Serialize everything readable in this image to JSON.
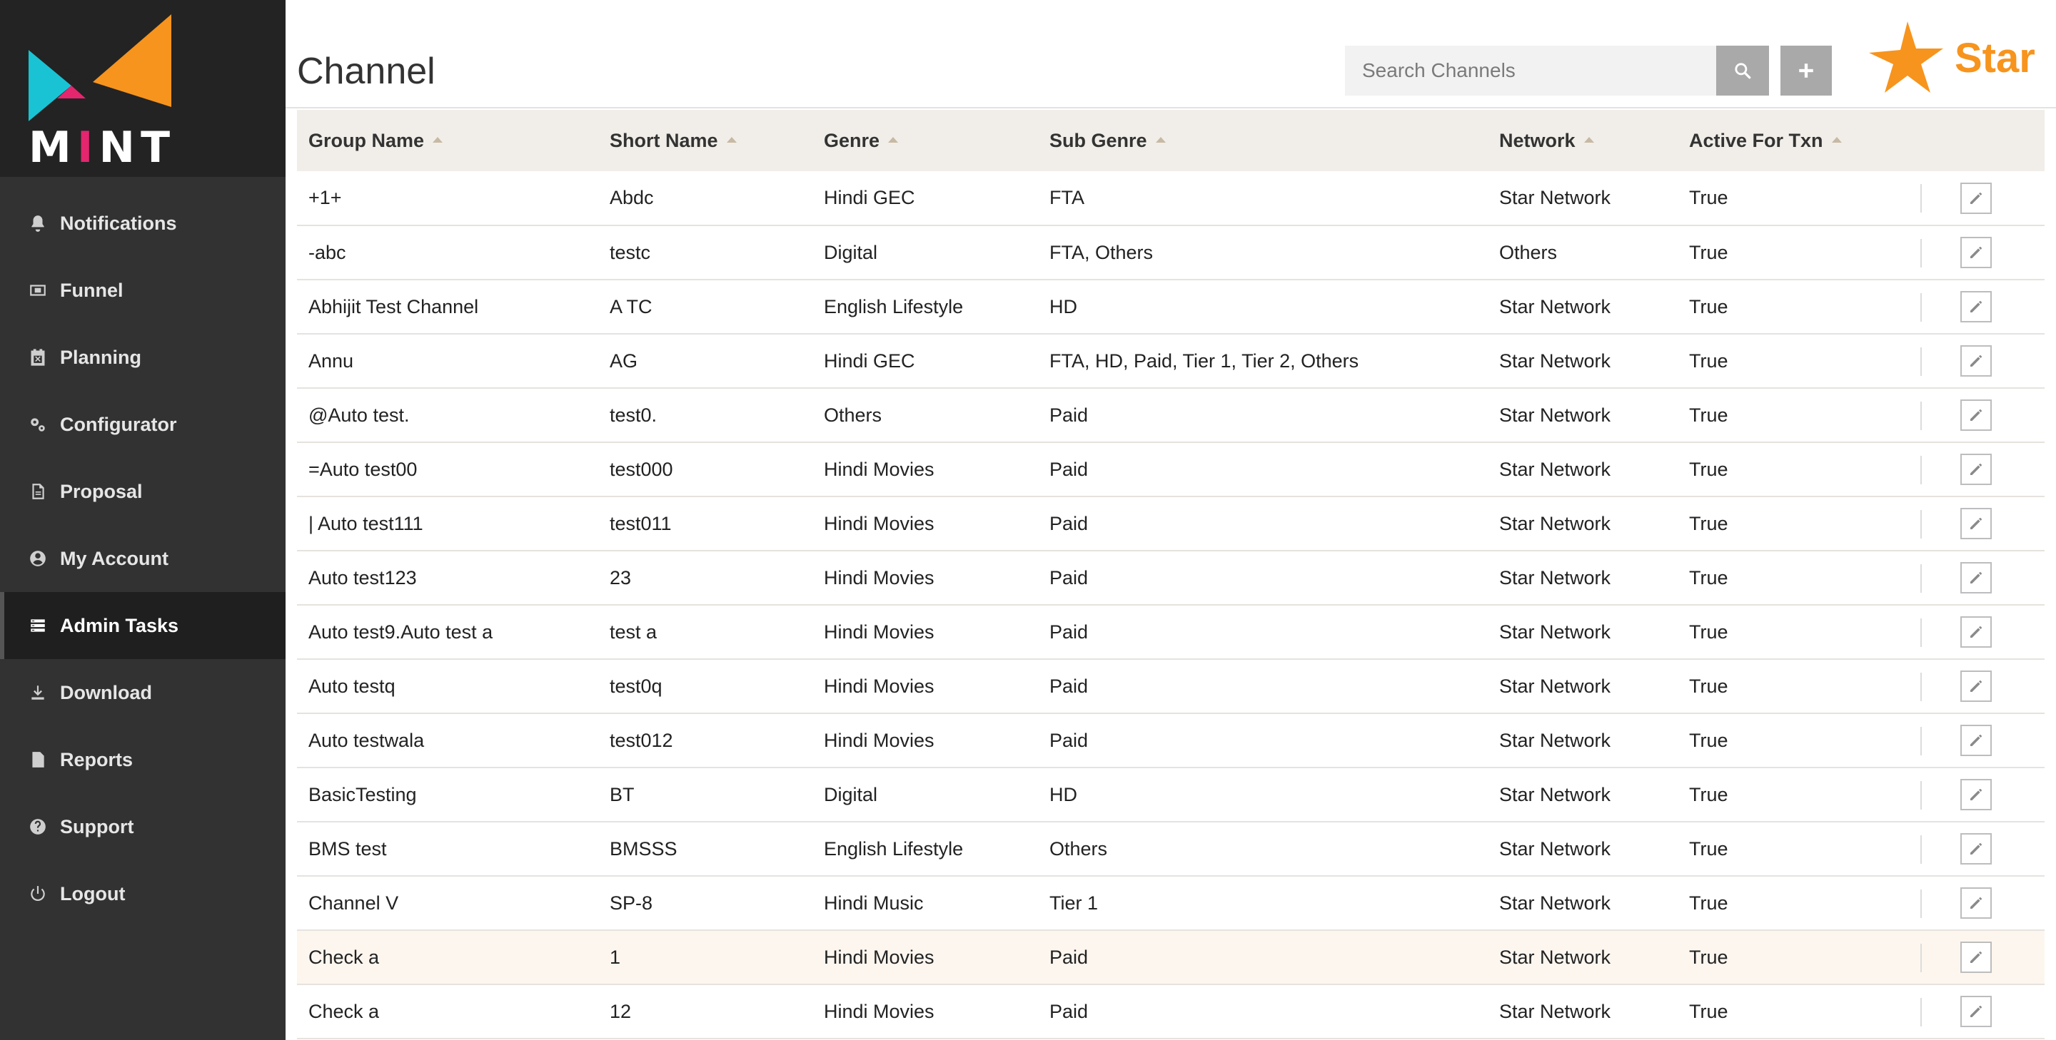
{
  "brand": {
    "logo_text": "MINT",
    "partner_logo_text": "Star"
  },
  "colors": {
    "sidebar_bg": "#323232",
    "accent_orange": "#f7941d",
    "logo_teal": "#19c3d3",
    "logo_pink": "#e3266e"
  },
  "sidebar": {
    "items": [
      {
        "label": "Notifications",
        "icon": "bell-icon",
        "active": false
      },
      {
        "label": "Funnel",
        "icon": "funnel-icon",
        "active": false
      },
      {
        "label": "Planning",
        "icon": "calendar-icon",
        "active": false
      },
      {
        "label": "Configurator",
        "icon": "gears-icon",
        "active": false
      },
      {
        "label": "Proposal",
        "icon": "document-icon",
        "active": false
      },
      {
        "label": "My Account",
        "icon": "user-circle-icon",
        "active": false
      },
      {
        "label": "Admin Tasks",
        "icon": "tasks-icon",
        "active": true
      },
      {
        "label": "Download",
        "icon": "download-icon",
        "active": false
      },
      {
        "label": "Reports",
        "icon": "report-icon",
        "active": false
      },
      {
        "label": "Support",
        "icon": "question-icon",
        "active": false
      },
      {
        "label": "Logout",
        "icon": "power-icon",
        "active": false
      }
    ]
  },
  "header": {
    "title": "Channel",
    "search_placeholder": "Search Channels",
    "search_icon": "search-icon",
    "add_icon": "plus-icon"
  },
  "table": {
    "columns": [
      "Group Name",
      "Short Name",
      "Genre",
      "Sub Genre",
      "Network",
      "Active For Txn"
    ],
    "rows": [
      [
        "+1+",
        "Abdc",
        "Hindi GEC",
        "FTA",
        "Star Network",
        "True"
      ],
      [
        "-abc",
        "testc",
        "Digital",
        "FTA, Others",
        "Others",
        "True"
      ],
      [
        "Abhijit Test Channel",
        "A TC",
        "English Lifestyle",
        "HD",
        "Star Network",
        "True"
      ],
      [
        "Annu",
        "AG",
        "Hindi GEC",
        "FTA, HD, Paid, Tier 1, Tier 2, Others",
        "Star Network",
        "True"
      ],
      [
        "@Auto test.",
        "test0.",
        "Others",
        "Paid",
        "Star Network",
        "True"
      ],
      [
        "=Auto test00",
        "test000",
        "Hindi Movies",
        "Paid",
        "Star Network",
        "True"
      ],
      [
        "| Auto test111",
        "test011",
        "Hindi Movies",
        "Paid",
        "Star Network",
        "True"
      ],
      [
        "Auto test123",
        "23",
        "Hindi Movies",
        "Paid",
        "Star Network",
        "True"
      ],
      [
        "Auto test9.Auto test a",
        "test a",
        "Hindi Movies",
        "Paid",
        "Star Network",
        "True"
      ],
      [
        "Auto testq",
        "test0q",
        "Hindi Movies",
        "Paid",
        "Star Network",
        "True"
      ],
      [
        "Auto testwala",
        "test012",
        "Hindi Movies",
        "Paid",
        "Star Network",
        "True"
      ],
      [
        "BasicTesting",
        "BT",
        "Digital",
        "HD",
        "Star Network",
        "True"
      ],
      [
        "BMS test",
        "BMSSS",
        "English Lifestyle",
        "Others",
        "Star Network",
        "True"
      ],
      [
        "Channel V",
        "SP-8",
        "Hindi Music",
        "Tier 1",
        "Star Network",
        "True"
      ],
      [
        "Check a",
        "1",
        "Hindi Movies",
        "Paid",
        "Star Network",
        "True"
      ],
      [
        "Check a",
        "12",
        "Hindi Movies",
        "Paid",
        "Star Network",
        "True"
      ]
    ],
    "highlighted_row": 14,
    "row_action_icon": "pencil-icon"
  }
}
